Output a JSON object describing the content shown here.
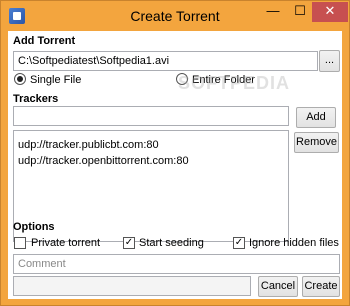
{
  "window": {
    "title": "Create Torrent",
    "controls": {
      "minimize": "—",
      "maximize": "☐",
      "close": "✕"
    }
  },
  "add_torrent": {
    "heading": "Add Torrent",
    "path_value": "C:\\Softpediatest\\Softpedia1.avi",
    "browse_label": "...",
    "mode_single": "Single File",
    "mode_folder": "Entire Folder",
    "selected_mode": "single"
  },
  "watermark": "SOFTPEDIA",
  "trackers": {
    "heading": "Trackers",
    "input_value": "",
    "add_label": "Add",
    "remove_label": "Remove",
    "items": [
      "udp://tracker.publicbt.com:80",
      "udp://tracker.openbittorrent.com:80"
    ]
  },
  "options": {
    "heading": "Options",
    "private_label": "Private torrent",
    "private_checked": false,
    "seed_label": "Start seeding",
    "seed_checked": true,
    "ignore_label": "Ignore hidden files",
    "ignore_checked": true,
    "comment_placeholder": "Comment",
    "comment_value": ""
  },
  "footer": {
    "cancel_label": "Cancel",
    "create_label": "Create"
  }
}
